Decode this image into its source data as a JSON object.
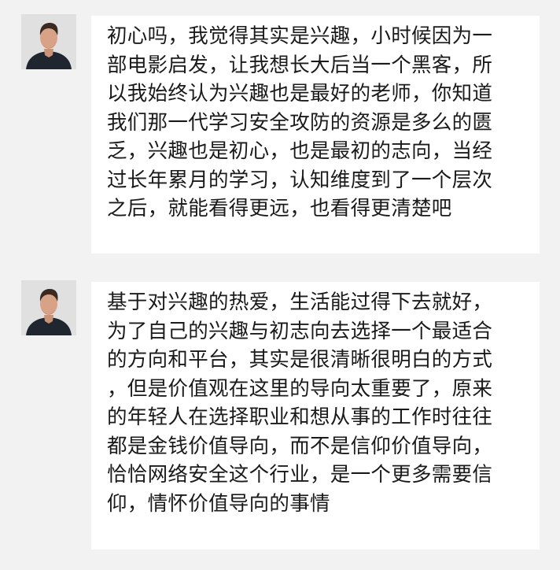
{
  "messages": [
    {
      "avatar_icon": "man-portrait-avatar",
      "lines": [
        "初心吗，我觉得其实是兴趣，小时候因为一",
        "部电影启发，让我想长大后当一个黑客，所",
        "以我始终认为兴趣也是最好的老师，你知道",
        "我们那一代学习安全攻防的资源是多么的匮",
        "乏，兴趣也是初心，也是最初的志向，当经",
        "过长年累月的学习，认知维度到了一个层次",
        "之后，就能看得更远，也看得更清楚吧"
      ]
    },
    {
      "avatar_icon": "man-portrait-avatar",
      "lines": [
        "基于对兴趣的热爱，生活能过得下去就好，",
        "为了自己的兴趣与初志向去选择一个最适合",
        "的方向和平台，其实是很清晰很明白的方式",
        "，但是价值观在这里的导向太重要了，原来",
        "的年轻人在选择职业和想从事的工作时往往",
        "都是金钱价值导向，而不是信仰价值导向，",
        "恰恰网络安全这个行业，是一个更多需要信",
        "仰，情怀价值导向的事情"
      ]
    }
  ]
}
